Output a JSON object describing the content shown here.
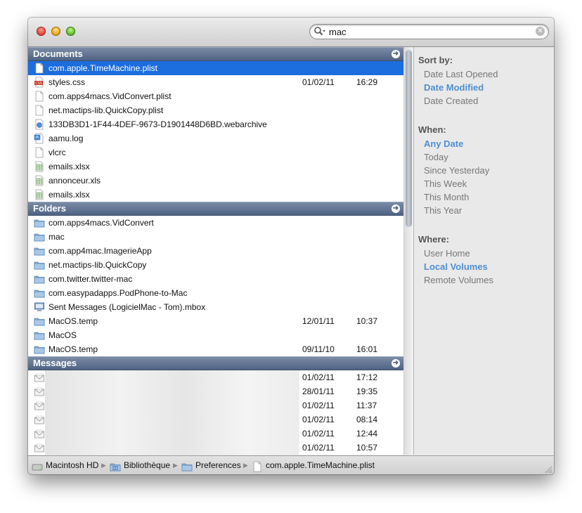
{
  "search": {
    "value": "mac"
  },
  "documents": {
    "header": "Documents",
    "rows": [
      {
        "icon": "plist-file-icon",
        "name": "com.apple.TimeMachine.plist",
        "date": "",
        "time": ""
      },
      {
        "icon": "css-file-icon",
        "name": "styles.css",
        "date": "01/02/11",
        "time": "16:29"
      },
      {
        "icon": "plist-file-icon",
        "name": "com.apps4macs.VidConvert.plist",
        "date": "",
        "time": ""
      },
      {
        "icon": "plist-file-icon",
        "name": "net.mactips-lib.QuickCopy.plist",
        "date": "",
        "time": ""
      },
      {
        "icon": "webarchive-file-icon",
        "name": "133DB3D1-1F44-4DEF-9673-D1901448D6BD.webarchive",
        "date": "",
        "time": ""
      },
      {
        "icon": "log-file-icon",
        "name": "aamu.log",
        "date": "",
        "time": ""
      },
      {
        "icon": "text-file-icon",
        "name": "vlcrc",
        "date": "",
        "time": ""
      },
      {
        "icon": "spreadsheet-file-icon",
        "name": "emails.xlsx",
        "date": "",
        "time": ""
      },
      {
        "icon": "spreadsheet-file-icon",
        "name": "annonceur.xls",
        "date": "",
        "time": ""
      },
      {
        "icon": "spreadsheet-file-icon",
        "name": "emails.xlsx",
        "date": "",
        "time": ""
      }
    ]
  },
  "folders": {
    "header": "Folders",
    "rows": [
      {
        "icon": "folder-icon",
        "name": "com.apps4macs.VidConvert",
        "date": "",
        "time": ""
      },
      {
        "icon": "folder-icon",
        "name": "mac",
        "date": "",
        "time": ""
      },
      {
        "icon": "folder-icon",
        "name": "com.app4mac.ImagerieApp",
        "date": "",
        "time": ""
      },
      {
        "icon": "folder-icon",
        "name": "net.mactips-lib.QuickCopy",
        "date": "",
        "time": ""
      },
      {
        "icon": "folder-icon",
        "name": "com.twitter.twitter-mac",
        "date": "",
        "time": ""
      },
      {
        "icon": "folder-icon",
        "name": "com.easypadapps.PodPhone-to-Mac",
        "date": "",
        "time": ""
      },
      {
        "icon": "mbox-icon",
        "name": "Sent Messages (LogicielMac - Tom).mbox",
        "date": "",
        "time": ""
      },
      {
        "icon": "folder-icon",
        "name": "MacOS.temp",
        "date": "12/01/11",
        "time": "10:37"
      },
      {
        "icon": "folder-icon",
        "name": "MacOS",
        "date": "",
        "time": ""
      },
      {
        "icon": "folder-icon",
        "name": "MacOS.temp",
        "date": "09/11/10",
        "time": "16:01"
      }
    ]
  },
  "messages": {
    "header": "Messages",
    "rows": [
      {
        "icon": "envelope-icon",
        "date": "01/02/11",
        "time": "17:12"
      },
      {
        "icon": "envelope-icon",
        "date": "28/01/11",
        "time": "19:35"
      },
      {
        "icon": "envelope-icon",
        "date": "01/02/11",
        "time": "11:37"
      },
      {
        "icon": "envelope-icon",
        "date": "01/02/11",
        "time": "08:14"
      },
      {
        "icon": "envelope-icon",
        "date": "01/02/11",
        "time": "12:44"
      },
      {
        "icon": "envelope-icon",
        "date": "01/02/11",
        "time": "10:57"
      }
    ]
  },
  "sidebar": {
    "sort": {
      "title": "Sort by:",
      "items": [
        "Date Last Opened",
        "Date Modified",
        "Date Created"
      ],
      "active": 1
    },
    "when": {
      "title": "When:",
      "items": [
        "Any Date",
        "Today",
        "Since Yesterday",
        "This Week",
        "This Month",
        "This Year"
      ],
      "active": 0
    },
    "where": {
      "title": "Where:",
      "items": [
        "User Home",
        "Local Volumes",
        "Remote Volumes"
      ],
      "active": 1
    }
  },
  "path": {
    "items": [
      {
        "icon": "hard-drive-icon",
        "label": "Macintosh HD"
      },
      {
        "icon": "library-folder-icon",
        "label": "Bibliothèque"
      },
      {
        "icon": "folder-icon",
        "label": "Preferences"
      },
      {
        "icon": "plist-file-icon",
        "label": "com.apple.TimeMachine.plist"
      }
    ]
  },
  "colors": {
    "selection": "#1c6ddd",
    "header": "#5a6d8c",
    "sidebar_active": "#4f8fd3"
  }
}
